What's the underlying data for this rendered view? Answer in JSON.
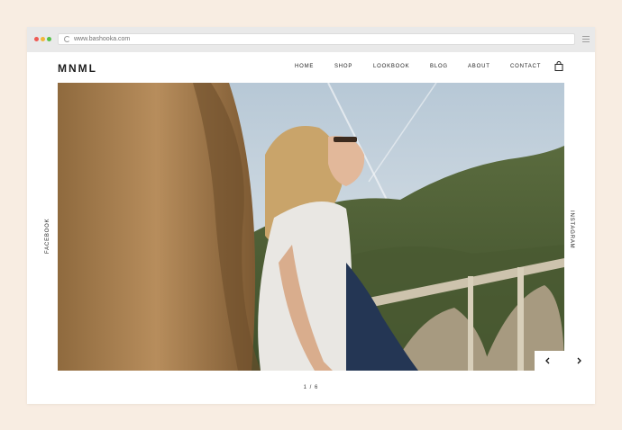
{
  "browser": {
    "url": "www.bashooka.com",
    "traffic_lights": [
      "#ee5b55",
      "#f2b63a",
      "#55c148"
    ]
  },
  "site": {
    "logo": "MNML",
    "nav": [
      "HOME",
      "SHOP",
      "LOOKBOOK",
      "BLOG",
      "ABOUT",
      "CONTACT"
    ],
    "social_left": "FACEBOOK",
    "social_right": "INSTAGRAM",
    "slide_counter": "1 / 6"
  },
  "icons": {
    "cart": "shopping-bag-icon",
    "prev": "chevron-left-icon",
    "next": "chevron-right-icon"
  },
  "colors": {
    "page_background": "#f8ede2",
    "text": "#1c1c1c"
  }
}
